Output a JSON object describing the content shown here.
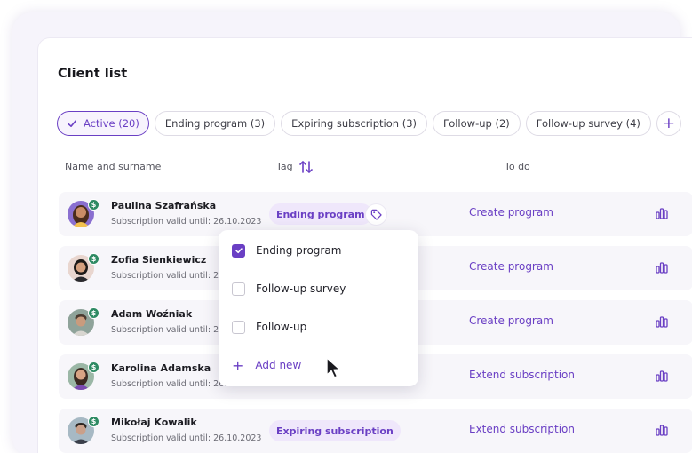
{
  "page": {
    "title": "Client list"
  },
  "filters": [
    {
      "label": "Active (20)",
      "active": true
    },
    {
      "label": "Ending program (3)",
      "active": false
    },
    {
      "label": "Expiring subscription (3)",
      "active": false
    },
    {
      "label": "Follow-up (2)",
      "active": false
    },
    {
      "label": "Follow-up survey (4)",
      "active": false
    }
  ],
  "add_filter": {
    "label": "+"
  },
  "columns": {
    "name": "Name and surname",
    "tag": "Tag",
    "todo": "To do"
  },
  "clients": [
    {
      "name": "Paulina Szafrańska",
      "subscription": "Subscription valid until: 26.10.2023",
      "tag": "Ending program",
      "todo": "Create program",
      "avatar_icon": "woman-avatar"
    },
    {
      "name": "Zofia Sienkiewicz",
      "subscription": "Subscription valid until: 26.10.2023",
      "tag": "",
      "todo": "Create program",
      "avatar_icon": "woman-avatar"
    },
    {
      "name": "Adam Woźniak",
      "subscription": "Subscription valid until: 26.10.2023",
      "tag": "",
      "todo": "Create program",
      "avatar_icon": "man-avatar"
    },
    {
      "name": "Karolina Adamska",
      "subscription": "Subscription valid until: 26.10.2023",
      "tag": "",
      "todo": "Extend subscription",
      "avatar_icon": "woman-avatar"
    },
    {
      "name": "Mikołaj Kowalik",
      "subscription": "Subscription valid until: 26.10.2023",
      "tag": "Expiring subscription",
      "todo": "Extend subscription",
      "avatar_icon": "man-avatar"
    }
  ],
  "badge": {
    "symbol": "$"
  },
  "tag_dropdown": {
    "options": [
      {
        "label": "Ending program",
        "checked": true
      },
      {
        "label": "Follow-up survey",
        "checked": false
      },
      {
        "label": "Follow-up",
        "checked": false
      }
    ],
    "add_label": "Add new",
    "add_symbol": "+"
  },
  "colors": {
    "accent": "#6a3fc4",
    "badge_green": "#2e8a63",
    "row_bg": "#f7f6fa",
    "tag_bg": "#efe7fb"
  },
  "icons": [
    "check-icon",
    "sort-icon",
    "tag-icon",
    "bar-chart-icon",
    "dollar-badge-icon",
    "mouse-cursor-icon"
  ]
}
